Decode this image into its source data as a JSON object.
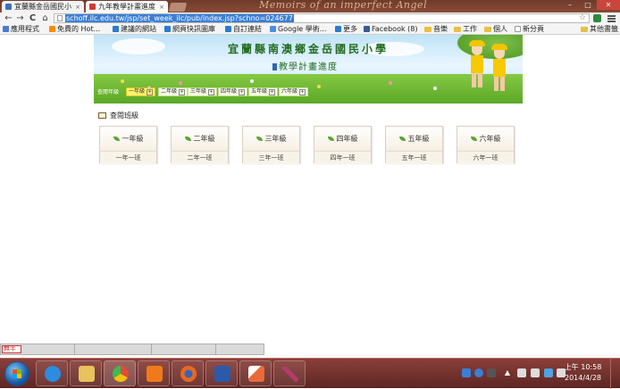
{
  "browser": {
    "tabs": [
      {
        "title": "宜蘭縣金岳國民小",
        "favicon_color": "#3b6fc2",
        "active": false
      },
      {
        "title": "九年教學計畫進度",
        "favicon_color": "#d23a2f",
        "active": true
      }
    ],
    "tab_close_glyph": "×",
    "theme_text": "Memoirs of an imperfect Angel",
    "window_controls": {
      "minimize": "–",
      "maximize": "□",
      "close": "✕"
    },
    "nav": {
      "back": "←",
      "forward": "→",
      "reload": "C",
      "home": "⌂"
    },
    "url": "schoff.ilc.edu.tw/jsp/set_week_ilc/pub/index.jsp?schno=024677",
    "star_glyph": "☆",
    "bookmarks": [
      {
        "label": "應用程式",
        "icon_color": "#4a7bd8"
      },
      {
        "label": "免費的 Hot...",
        "icon_color": "#ff8a00"
      },
      {
        "label": "建議的網站",
        "icon_color": "#2a7bd1"
      },
      {
        "label": "網頁快訊圖庫",
        "icon_color": "#2a7bd1"
      },
      {
        "label": "自訂連結",
        "icon_color": "#2a7bd1"
      },
      {
        "label": "Google 學術...",
        "icon_color": "#4a90e2"
      },
      {
        "label": "更多",
        "icon_color": "#2a7bd1"
      },
      {
        "label": "Facebook (8)",
        "icon_color": "#3b5998"
      },
      {
        "label": "音樂",
        "icon_color": "folder"
      },
      {
        "label": "工作",
        "icon_color": "folder"
      },
      {
        "label": "個人",
        "icon_color": "folder"
      },
      {
        "label": "新分頁",
        "icon_color": "#ffffff"
      }
    ],
    "other_bookmarks": "其他書籤"
  },
  "page": {
    "school_name": "宜蘭縣南澳鄉金岳國民小學",
    "subtitle": "教學計畫進度",
    "grade_bar_label": "查閱年級",
    "grade_tabs": [
      {
        "label": "一年級",
        "active": true
      },
      {
        "label": "二年級",
        "active": false
      },
      {
        "label": "三年級",
        "active": false
      },
      {
        "label": "四年級",
        "active": false
      },
      {
        "label": "五年級",
        "active": false
      },
      {
        "label": "六年級",
        "active": false
      }
    ],
    "plus_glyph": "+",
    "section_title": "查閱班級",
    "grade_cards": [
      {
        "grade": "一年級",
        "class": "一年一班"
      },
      {
        "grade": "二年級",
        "class": "二年一班"
      },
      {
        "grade": "三年級",
        "class": "三年一班"
      },
      {
        "grade": "四年級",
        "class": "四年一班"
      },
      {
        "grade": "五年級",
        "class": "五年一班"
      },
      {
        "grade": "六年級",
        "class": "六年一班"
      }
    ]
  },
  "ime": {
    "mode_text": "無半"
  },
  "taskbar": {
    "apps": [
      {
        "name": "internet-explorer",
        "color": "#2d8be0"
      },
      {
        "name": "file-explorer",
        "color": "#e8c25a"
      },
      {
        "name": "chrome",
        "color": "#e04b3a"
      },
      {
        "name": "media-player",
        "color": "#f07a1a"
      },
      {
        "name": "firefox",
        "color": "#e86a1c"
      },
      {
        "name": "word",
        "color": "#2b5aa8"
      },
      {
        "name": "paint",
        "color": "#e96b3a"
      },
      {
        "name": "pen-tool",
        "color": "#b23b6b"
      }
    ],
    "clock_time": "上午 10:58",
    "clock_date": "2014/4/28"
  }
}
